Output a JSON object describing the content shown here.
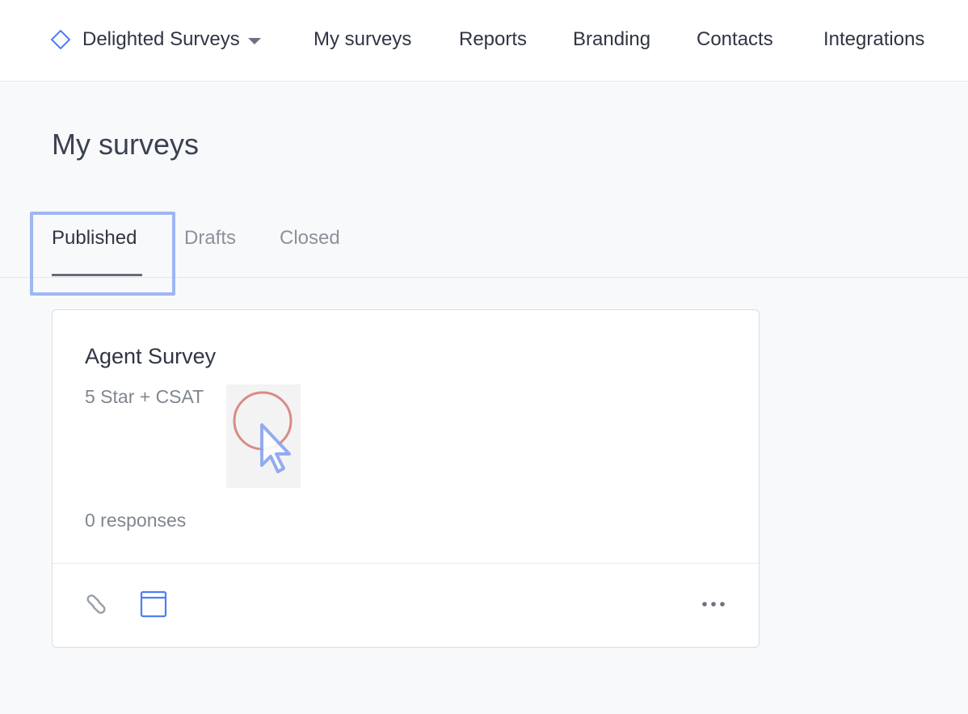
{
  "header": {
    "workspace_label": "Delighted Surveys",
    "nav": [
      {
        "label": "My surveys"
      },
      {
        "label": "Reports"
      },
      {
        "label": "Branding"
      },
      {
        "label": "Contacts"
      },
      {
        "label": "Integrations"
      }
    ]
  },
  "page": {
    "title": "My surveys",
    "tabs": [
      {
        "label": "Published",
        "active": true
      },
      {
        "label": "Drafts",
        "active": false
      },
      {
        "label": "Closed",
        "active": false
      }
    ]
  },
  "survey_card": {
    "title": "Agent Survey",
    "type": "5 Star + CSAT",
    "responses": "0 responses",
    "actions": [
      "link-icon",
      "web-embed-icon",
      "more-icon"
    ]
  },
  "colors": {
    "accent": "#4d7ff0",
    "focus_ring": "#9fb5f4",
    "cursor_click": "#c9534a"
  }
}
